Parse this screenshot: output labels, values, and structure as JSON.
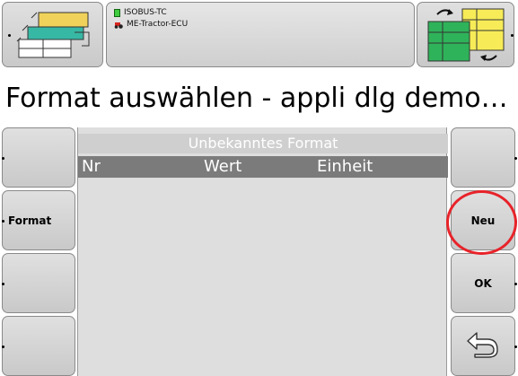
{
  "top": {
    "info_lines": [
      {
        "icon": "document-icon",
        "text": "ISOBUS-TC"
      },
      {
        "icon": "tractor-icon",
        "text": "ME-Tractor-ECU"
      }
    ],
    "left_softkey_icon": "workset-layout-icon",
    "right_softkey_icon": "workset-switch-icon"
  },
  "title": "Format auswählen - appli dlg demo…",
  "list": {
    "title": "Unbekanntes Format",
    "columns": [
      "Nr",
      "Wert",
      "Einheit"
    ],
    "rows": []
  },
  "left_softkeys": [
    {
      "label": ""
    },
    {
      "label": "Format"
    },
    {
      "label": ""
    },
    {
      "label": ""
    }
  ],
  "right_softkeys": [
    {
      "label": ""
    },
    {
      "label": "Neu",
      "highlighted": true
    },
    {
      "label": "OK"
    },
    {
      "label": "",
      "icon": "back-arrow-icon"
    }
  ],
  "colors": {
    "header_bg": "#7b7b7b",
    "highlight_circle": "#e8232a"
  }
}
